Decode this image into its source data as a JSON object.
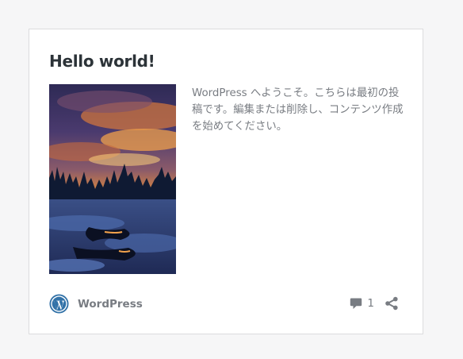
{
  "post": {
    "title": "Hello world!",
    "excerpt": "WordPress へようこそ。こちらは最初の投稿です。編集または削除し、コンテンツ作成を始めてください。",
    "author": "WordPress",
    "comment_count": "1",
    "thumbnail_icon": "snowy-forest-sunset-photo"
  },
  "icons": {
    "author_logo": "wordpress-logo-icon",
    "comments": "comment-bubble-icon",
    "share": "share-icon"
  },
  "colors": {
    "background": "#f6f6f7",
    "card": "#ffffff",
    "title": "#2c3338",
    "muted_text": "#787c82",
    "wp_blue": "#3272a8"
  }
}
